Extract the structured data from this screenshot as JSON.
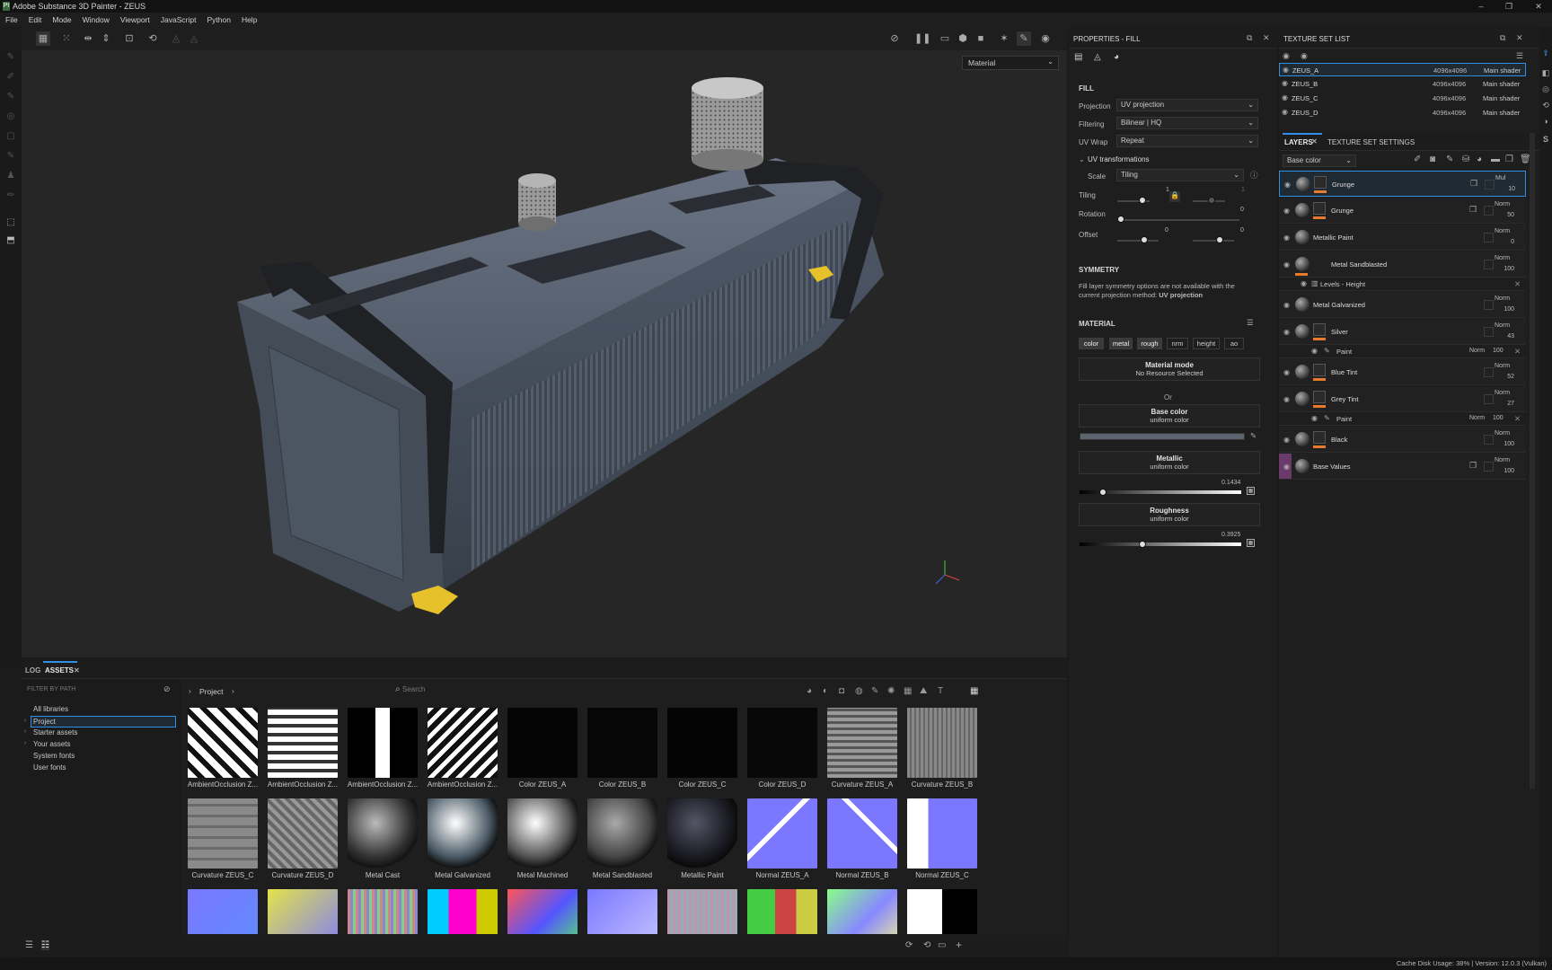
{
  "window": {
    "title": "Adobe Substance 3D Painter - ZEUS",
    "app_badge": "Pt"
  },
  "menu": [
    "File",
    "Edit",
    "Mode",
    "Window",
    "Viewport",
    "JavaScript",
    "Python",
    "Help"
  ],
  "viewport": {
    "display_mode": "Material"
  },
  "assets_panel": {
    "tabs": [
      "LOG",
      "ASSETS"
    ],
    "filter_placeholder": "FILTER BY PATH",
    "libraries": [
      "All libraries",
      "Project",
      "Starter assets",
      "Your assets",
      "System fonts",
      "User fonts"
    ],
    "breadcrumb": "Project",
    "search_placeholder": "Search",
    "items": [
      "AmbientOcclusion Z...",
      "AmbientOcclusion Z...",
      "AmbientOcclusion Z...",
      "AmbientOcclusion Z...",
      "Color ZEUS_A",
      "Color ZEUS_B",
      "Color ZEUS_C",
      "Color ZEUS_D",
      "Curvature ZEUS_A",
      "Curvature ZEUS_B",
      "Curvature ZEUS_C",
      "Curvature ZEUS_D",
      "Metal Cast",
      "Metal Galvanized",
      "Metal Machined",
      "Metal Sandblasted",
      "Metallic Paint",
      "Normal ZEUS_A",
      "Normal ZEUS_B",
      "Normal ZEUS_C",
      "",
      "",
      "",
      "",
      "",
      "",
      "",
      "",
      "",
      ""
    ]
  },
  "properties": {
    "header": "PROPERTIES - FILL",
    "fill_section": "FILL",
    "projection": {
      "label": "Projection",
      "value": "UV projection"
    },
    "filtering": {
      "label": "Filtering",
      "value": "Bilinear | HQ"
    },
    "uv_wrap": {
      "label": "UV Wrap",
      "value": "Repeat"
    },
    "uv_transformations": "UV transformations",
    "scale": {
      "label": "Scale",
      "value": "Tiling"
    },
    "tiling": {
      "label": "Tiling",
      "value_a": "1",
      "value_b": "1"
    },
    "rotation": {
      "label": "Rotation",
      "value": "0"
    },
    "offset": {
      "label": "Offset",
      "value_a": "0",
      "value_b": "0"
    },
    "symmetry_section": "SYMMETRY",
    "symmetry_note": "Fill layer symmetry options are not available with the current projection method:",
    "symmetry_method": "UV projection",
    "material_section": "MATERIAL",
    "channels": [
      "color",
      "metal",
      "rough",
      "nrm",
      "height",
      "ao"
    ],
    "material_mode": {
      "title": "Material mode",
      "value": "No Resource Selected"
    },
    "or": "Or",
    "base_color": {
      "title": "Base color",
      "value": "uniform color",
      "swatch": "#5c6470"
    },
    "metallic": {
      "title": "Metallic",
      "value": "uniform color",
      "number": "0.1434"
    },
    "roughness": {
      "title": "Roughness",
      "value": "uniform color",
      "number": "0.3925"
    }
  },
  "texture_sets": {
    "header": "TEXTURE SET LIST",
    "rows": [
      {
        "name": "ZEUS_A",
        "res": "4096x4096",
        "shader": "Main shader"
      },
      {
        "name": "ZEUS_B",
        "res": "4096x4096",
        "shader": "Main shader"
      },
      {
        "name": "ZEUS_C",
        "res": "4096x4096",
        "shader": "Main shader"
      },
      {
        "name": "ZEUS_D",
        "res": "4096x4096",
        "shader": "Main shader"
      }
    ]
  },
  "layers": {
    "tabs": [
      "LAYERS",
      "TEXTURE SET SETTINGS"
    ],
    "channel": "Base color",
    "items": [
      {
        "name": "Grunge",
        "blend": "Mul",
        "opacity": "10"
      },
      {
        "name": "Grunge",
        "blend": "Norm",
        "opacity": "50"
      },
      {
        "name": "Metallic Paint",
        "blend": "Norm",
        "opacity": "0"
      },
      {
        "name": "Metal Sandblasted",
        "blend": "Norm",
        "opacity": "100"
      },
      {
        "name": "Metal Galvanized",
        "blend": "Norm",
        "opacity": "100"
      },
      {
        "name": "Silver",
        "blend": "Norm",
        "opacity": "43"
      },
      {
        "name": "Blue Tint",
        "blend": "Norm",
        "opacity": "52"
      },
      {
        "name": "Grey Tint",
        "blend": "Norm",
        "opacity": "27"
      },
      {
        "name": "Black",
        "blend": "Norm",
        "opacity": "100"
      },
      {
        "name": "Base Values",
        "blend": "Norm",
        "opacity": "100"
      }
    ],
    "sub_levels": "Levels - Height",
    "sub_paint": "Paint",
    "sub_paint_blend": "Norm",
    "sub_paint_opacity": "100"
  },
  "status": "Cache Disk Usage:   38% | Version: 12.0.3 (Vulkan)"
}
